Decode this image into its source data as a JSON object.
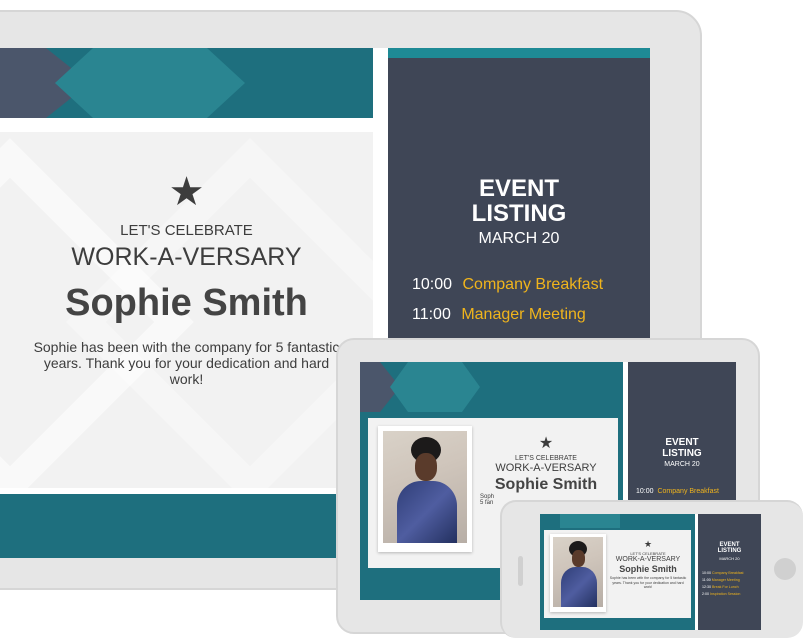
{
  "colors": {
    "teal": "#1e6f7e",
    "sidebar": "#3f4656",
    "accent": "#f0b41c",
    "panel": "#f2f2f2",
    "bezel": "#e6e6e6"
  },
  "celebration": {
    "icon": "star-icon",
    "kicker": "LET'S CELEBRATE",
    "headline": "WORK-A-VERSARY",
    "name": "Sophie Smith",
    "message": "Sophie has been with the company for 5 fantastic years. Thank you for your dedication and hard work!"
  },
  "events": {
    "title_line1": "EVENT",
    "title_line2": "LISTING",
    "date": "MARCH 20",
    "items": [
      {
        "time": "10:00",
        "name": "Company Breakfast"
      },
      {
        "time": "11:00",
        "name": "Manager Meeting"
      },
      {
        "time": "12:30",
        "name": "Break For Lunch"
      },
      {
        "time": "2:00",
        "name": "Inspiration Session"
      }
    ]
  },
  "tablet_preview": {
    "name_partial": "Sophie Smith",
    "message_partial": "Soph",
    "message_partial2": "5 fan"
  }
}
